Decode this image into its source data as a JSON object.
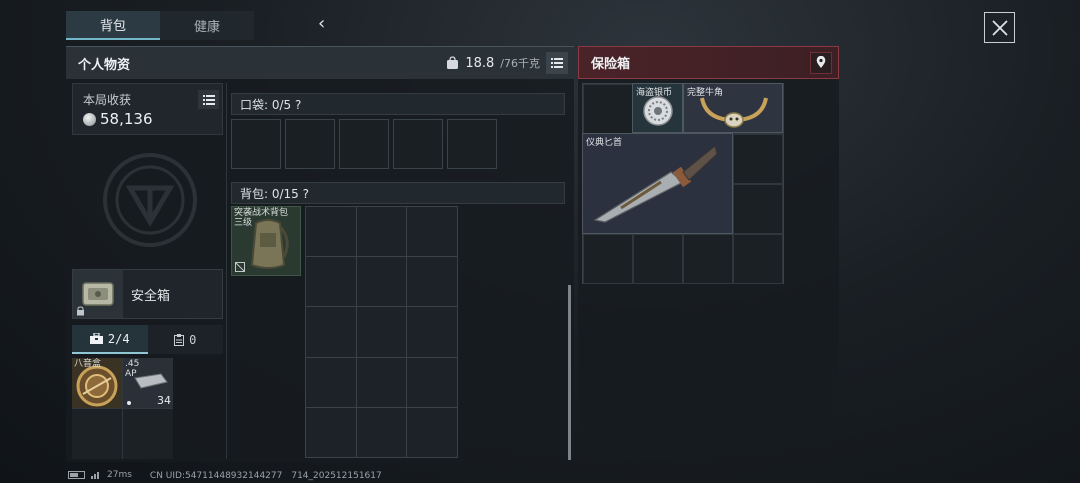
{
  "tabs": [
    {
      "label": "背包",
      "active": true
    },
    {
      "label": "健康",
      "active": false
    }
  ],
  "personal": {
    "title": "个人物资",
    "weight_current": "18.8",
    "weight_max": "/76千克"
  },
  "harvest": {
    "label": "本局收获",
    "value": "58,136"
  },
  "safebox": {
    "label": "安全箱"
  },
  "subtabs": [
    {
      "label": "2/4",
      "icon": "toolbox-icon",
      "active": true
    },
    {
      "label": "0",
      "icon": "clipboard-icon",
      "active": false
    }
  ],
  "safe_slots": [
    {
      "label": "八音盒",
      "count": ""
    },
    {
      "label": ".45\nAP",
      "count": "34"
    }
  ],
  "pocket": {
    "label": "口袋: 0/5 ?"
  },
  "backpack": {
    "label": "背包: 0/15 ?",
    "item_label": "突袭战术背包\n三级"
  },
  "vault": {
    "title": "保险箱",
    "items": [
      {
        "label": "海盗银币"
      },
      {
        "label": "完整牛角"
      },
      {
        "label": "仪典匕首"
      }
    ]
  },
  "status": {
    "ping": "27ms",
    "uid": "CN UID:54711448932144277　714_202512151617"
  },
  "colors": {
    "accent": "#6fb7c9",
    "vault_red": "#8a3a40"
  }
}
